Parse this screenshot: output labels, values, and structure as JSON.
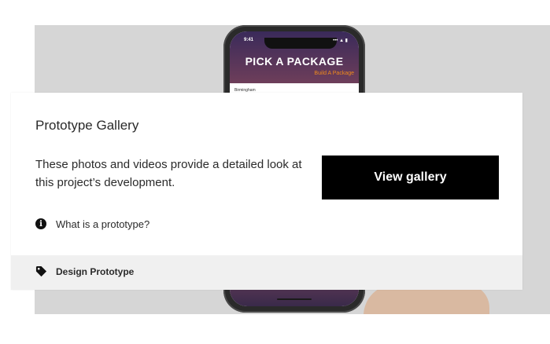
{
  "phone": {
    "status_time": "9:41",
    "status_icons": "••• ▲ ▮",
    "app_title": "PICK A PACKAGE",
    "app_subtitle": "Build A Package",
    "location": "Birmingham"
  },
  "card": {
    "title": "Prototype Gallery",
    "description": "These photos and videos provide a detailed look at this project’s development.",
    "button_label": "View gallery",
    "info_link": "What is a prototype?",
    "tag_label": "Design Prototype"
  },
  "colors": {
    "button_bg": "#000000",
    "footer_bg": "#f0f0f0",
    "hero_bg": "#d6d6d6"
  },
  "icons": {
    "info": "info-icon",
    "tag": "tag-icon"
  }
}
